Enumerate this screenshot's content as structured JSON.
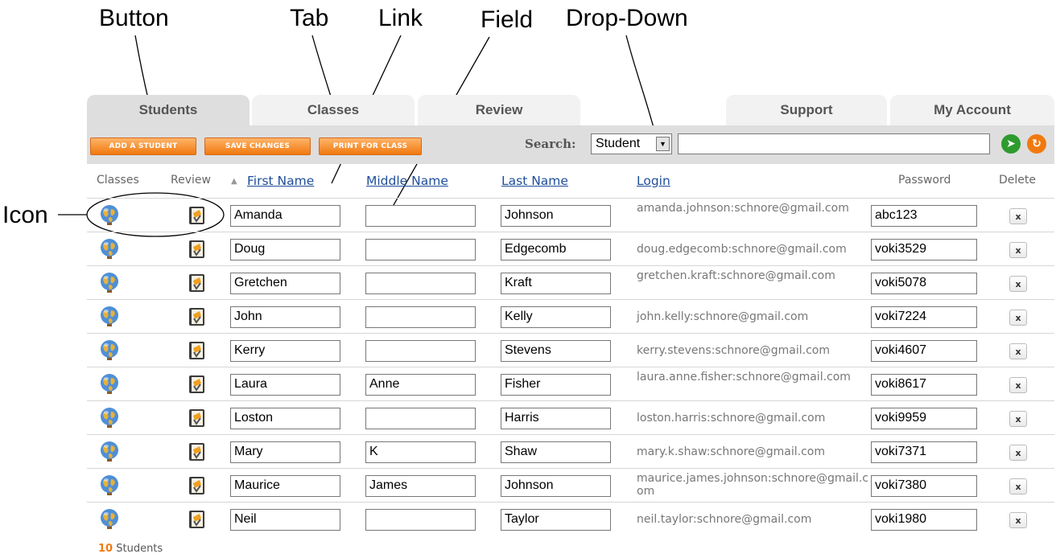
{
  "callouts": {
    "button": "Button",
    "tab": "Tab",
    "link": "Link",
    "field": "Field",
    "dropdown": "Drop-Down",
    "icon": "Icon"
  },
  "tabs": [
    "Students",
    "Classes",
    "Review",
    "Support",
    "My Account"
  ],
  "active_tab": "Students",
  "toolbar": {
    "add_student": "ADD A STUDENT",
    "save_changes": "SAVE CHANGES",
    "print_for_class": "PRINT FOR CLASS",
    "search_label": "Search:",
    "search_scope": "Student",
    "search_value": "",
    "go_color": "#2e9b2e",
    "reset_color": "#f07a10"
  },
  "columns": {
    "classes": "Classes",
    "review": "Review",
    "first_name": "First Name",
    "middle_name": "Middle Name",
    "last_name": "Last Name",
    "login": "Login",
    "password": "Password",
    "delete": "Delete"
  },
  "icons": {
    "classes_icon": "globe-icon",
    "review_icon": "book-icon",
    "delete_icon": "close-icon",
    "sort_icon": "sort-ascending-icon",
    "go_icon": "arrow-right-icon",
    "reset_icon": "refresh-icon"
  },
  "students": [
    {
      "first": "Amanda",
      "middle": "",
      "last": "Johnson",
      "login": "amanda.johnson:schnore@gmail.com",
      "password": "abc123"
    },
    {
      "first": "Doug",
      "middle": "",
      "last": "Edgecomb",
      "login": "doug.edgecomb:schnore@gmail.com",
      "password": "voki3529"
    },
    {
      "first": "Gretchen",
      "middle": "",
      "last": "Kraft",
      "login": "gretchen.kraft:schnore@gmail.com",
      "password": "voki5078"
    },
    {
      "first": "John",
      "middle": "",
      "last": "Kelly",
      "login": "john.kelly:schnore@gmail.com",
      "password": "voki7224"
    },
    {
      "first": "Kerry",
      "middle": "",
      "last": "Stevens",
      "login": "kerry.stevens:schnore@gmail.com",
      "password": "voki4607"
    },
    {
      "first": "Laura",
      "middle": "Anne",
      "last": "Fisher",
      "login": "laura.anne.fisher:schnore@gmail.com",
      "password": "voki8617"
    },
    {
      "first": "Loston",
      "middle": "",
      "last": "Harris",
      "login": "loston.harris:schnore@gmail.com",
      "password": "voki9959"
    },
    {
      "first": "Mary",
      "middle": "K",
      "last": "Shaw",
      "login": "mary.k.shaw:schnore@gmail.com",
      "password": "voki7371"
    },
    {
      "first": "Maurice",
      "middle": "James",
      "last": "Johnson",
      "login": "maurice.james.johnson:schnore@gmail.com",
      "password": "voki7380"
    },
    {
      "first": "Neil",
      "middle": "",
      "last": "Taylor",
      "login": "neil.taylor:schnore@gmail.com",
      "password": "voki1980"
    }
  ],
  "footer": {
    "count": "10",
    "label": "Students"
  }
}
